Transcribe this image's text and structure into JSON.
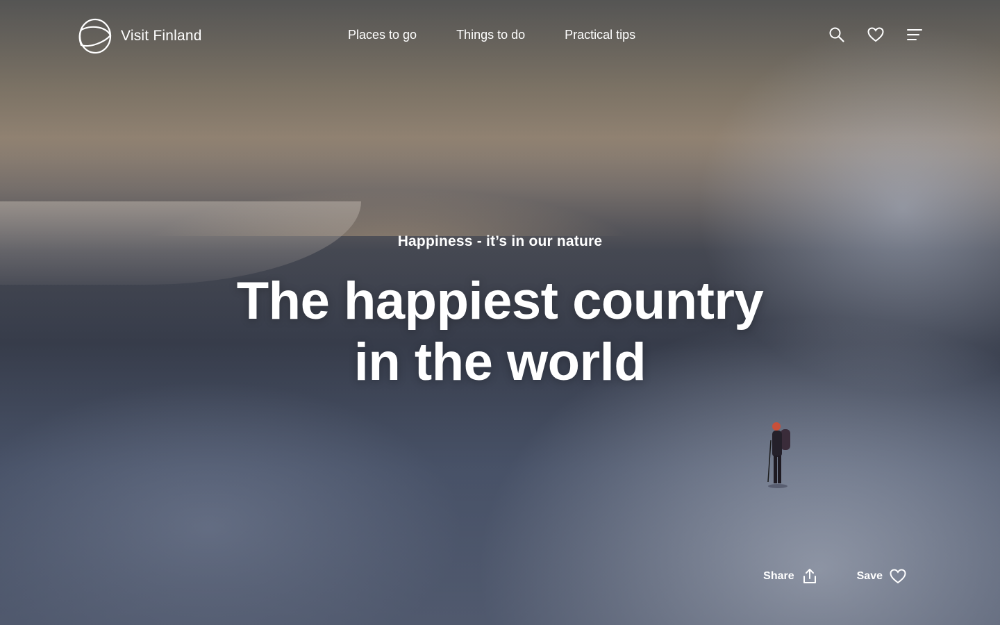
{
  "header": {
    "logo_text": "Visit Finland",
    "nav": [
      {
        "label": "Places to go"
      },
      {
        "label": "Things to do"
      },
      {
        "label": "Practical tips"
      }
    ],
    "icons": [
      "search-icon",
      "heart-icon",
      "menu-icon"
    ]
  },
  "hero": {
    "kicker": "Happiness - it’s in our nature",
    "headline_line1": "The happiest country",
    "headline_line2": "in the world"
  },
  "actions": {
    "share_label": "Share",
    "save_label": "Save"
  },
  "colors": {
    "text": "#ffffff"
  }
}
